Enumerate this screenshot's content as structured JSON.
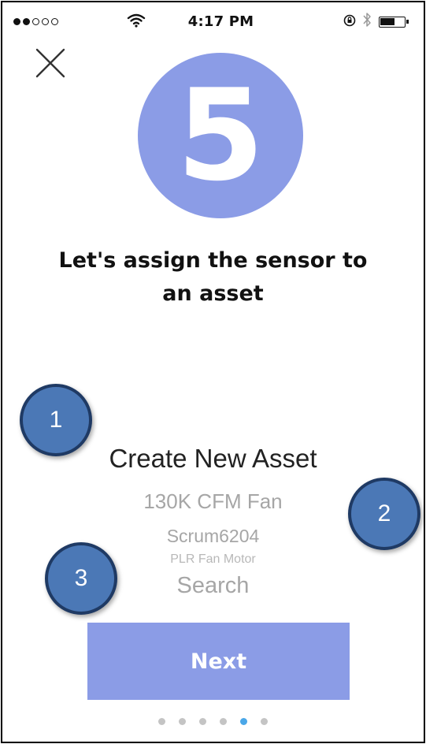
{
  "status_bar": {
    "signal_filled": 2,
    "signal_total": 5,
    "time": "4:17 PM",
    "icons": [
      "wifi-icon",
      "rotation-lock-icon",
      "bluetooth-icon",
      "battery-icon"
    ]
  },
  "close_icon": "close-icon",
  "step": {
    "number": "5"
  },
  "heading": {
    "line1": "Let's assign the sensor to",
    "line2": "an asset"
  },
  "picker": {
    "options": [
      {
        "label": "Create New Asset"
      },
      {
        "label": "130K CFM Fan"
      },
      {
        "label": "Scrum6204"
      },
      {
        "label": "PLR Fan Motor"
      },
      {
        "label": "Search"
      }
    ]
  },
  "callouts": [
    "1",
    "2",
    "3"
  ],
  "next_label": "Next",
  "pager": {
    "total": 6,
    "active_index": 4
  },
  "colors": {
    "accent": "#8b9ce6",
    "callout": "#4b78b6",
    "active_dot": "#4aa7e8",
    "inactive_dot": "#c4c4c4"
  }
}
